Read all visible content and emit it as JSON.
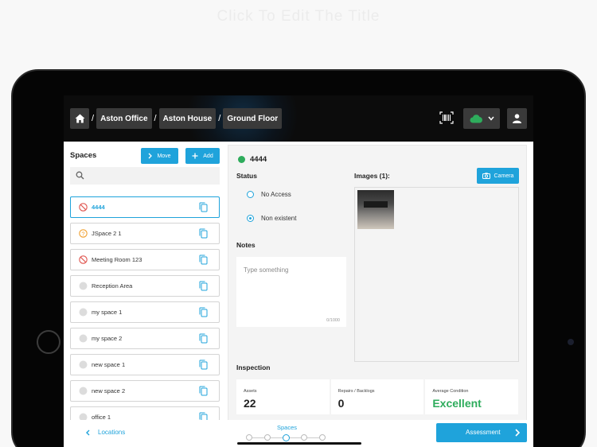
{
  "caption": "Click To Edit The Title",
  "header": {
    "breadcrumbs": [
      "Aston Office",
      "Aston House",
      "Ground Floor"
    ],
    "separator": "/"
  },
  "left_panel": {
    "title": "Spaces",
    "move_label": "Move",
    "add_label": "Add",
    "search_placeholder": "",
    "items": [
      {
        "label": "4444",
        "status": "no-entry",
        "active": true
      },
      {
        "label": "JSpace 2 1",
        "status": "unknown",
        "active": false
      },
      {
        "label": "Meeting Room 123",
        "status": "no-entry",
        "active": false
      },
      {
        "label": "Reception Area",
        "status": "none",
        "active": false
      },
      {
        "label": "my space 1",
        "status": "none",
        "active": false
      },
      {
        "label": "my space 2",
        "status": "none",
        "active": false
      },
      {
        "label": "new space  1",
        "status": "none",
        "active": false
      },
      {
        "label": "new space  2",
        "status": "none",
        "active": false
      },
      {
        "label": "office 1",
        "status": "none",
        "active": false
      }
    ]
  },
  "detail": {
    "space_name": "4444",
    "status_label": "Status",
    "status_options": [
      {
        "label": "No Access",
        "selected": false
      },
      {
        "label": "Non existent",
        "selected": true
      }
    ],
    "notes_label": "Notes",
    "notes_placeholder": "Type something",
    "notes_count": "0/1000",
    "images_label": "Images (1):",
    "camera_label": "Camera",
    "inspection_label": "Inspection",
    "stats": [
      {
        "label": "Assets",
        "value": "22"
      },
      {
        "label": "Repairs / Backlogs",
        "value": "0"
      },
      {
        "label": "Average Condition",
        "value": "Excellent"
      }
    ]
  },
  "footer": {
    "back_label": "Locations",
    "current_tab": "Spaces",
    "next_label": "Assessment",
    "step_count": 5,
    "current_step": 3
  },
  "colors": {
    "accent": "#1fa3db",
    "success": "#2eac5c",
    "header_bg": "#0c0c0c",
    "no_entry": "#e0554f",
    "unknown": "#f0a030"
  }
}
